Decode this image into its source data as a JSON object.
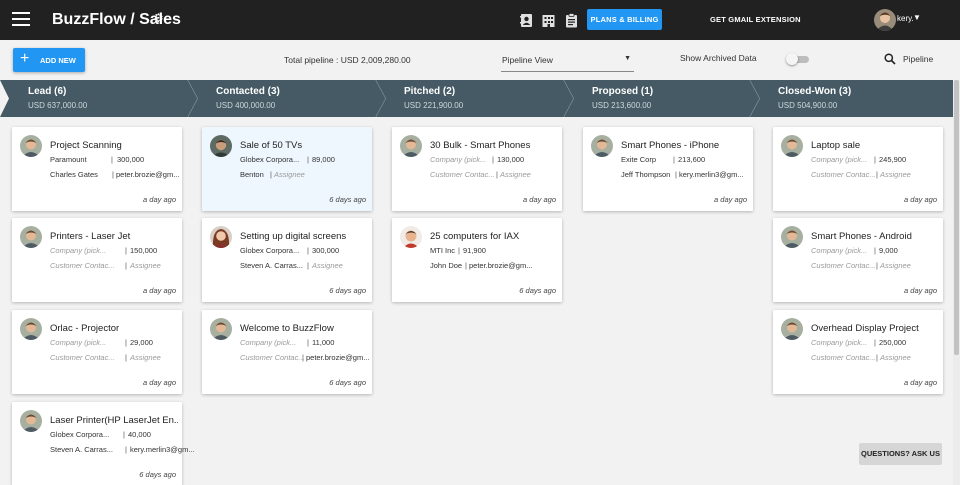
{
  "header": {
    "title": "BuzzFlow / Sales",
    "plans_button": "PLANS & BILLING",
    "gmail_extension": "GET GMAIL EXTENSION",
    "user_name": "kery.",
    "accent": "#2196f3",
    "bar_color": "#212121"
  },
  "toolbar": {
    "add_new": "ADD NEW",
    "total_pipeline": "Total pipeline : USD 2,009,280.00",
    "view_select": "Pipeline View",
    "archived_label": "Show Archived Data",
    "archived_on": false,
    "search_label": "Pipeline"
  },
  "stages": [
    {
      "name": "Lead (6)",
      "amount": "USD 637,000.00"
    },
    {
      "name": "Contacted (3)",
      "amount": "USD 400,000.00"
    },
    {
      "name": "Pitched (2)",
      "amount": "USD 221,900.00"
    },
    {
      "name": "Proposed (1)",
      "amount": "USD 213,600.00"
    },
    {
      "name": "Closed-Won (3)",
      "amount": "USD 504,900.00"
    }
  ],
  "cards": [
    {
      "title": "Project Scanning",
      "company": "Paramount",
      "value": "300,000",
      "contact": "Charles Gates",
      "assignee": "peter.brozie@gm...",
      "time": "a day ago"
    },
    {
      "title": "Printers - Laser Jet",
      "company": "Company (pick...",
      "value": "150,000",
      "contact": "Customer Contac...",
      "assignee": "Assignee",
      "time": "a day ago"
    },
    {
      "title": "Orlac - Projector",
      "company": "Company (pick...",
      "value": "29,000",
      "contact": "Customer Contac...",
      "assignee": "Assignee",
      "time": "a day ago"
    },
    {
      "title": "Laser Printer(HP LaserJet En...",
      "company": "Globex Corpora...",
      "value": "40,000",
      "contact": "Steven A. Carras...",
      "assignee": "kery.merlin3@gm...",
      "time": "6 days ago"
    },
    {
      "title": "Sale of 50 TVs",
      "company": "Globex Corpora...",
      "value": "89,000",
      "contact": "Benton",
      "assignee": "Assignee",
      "time": "6 days ago"
    },
    {
      "title": "Setting up digital screens",
      "company": "Globex Corpora...",
      "value": "300,000",
      "contact": "Steven A. Carras...",
      "assignee": "Assignee",
      "time": "6 days ago"
    },
    {
      "title": "Welcome to BuzzFlow",
      "company": "Company (pick...",
      "value": "11,000",
      "contact": "Customer Contac...",
      "assignee": "peter.brozie@gm...",
      "time": "6 days ago"
    },
    {
      "title": "30 Bulk - Smart Phones",
      "company": "Company (pick...",
      "value": "130,000",
      "contact": "Customer Contac...",
      "assignee": "Assignee",
      "time": "a day ago"
    },
    {
      "title": "25 computers for IAX",
      "company": "MTI Inc",
      "value": "91,900",
      "contact": "John Doe",
      "assignee": "peter.brozie@gm...",
      "time": "6 days ago"
    },
    {
      "title": "Smart Phones - iPhone",
      "company": "Exite Corp",
      "value": "213,600",
      "contact": "Jeff Thompson",
      "assignee": "kery.merlin3@gm...",
      "time": "a day ago"
    },
    {
      "title": "Laptop sale",
      "company": "Company (pick...",
      "value": "245,900",
      "contact": "Customer Contac...",
      "assignee": "Assignee",
      "time": "a day ago"
    },
    {
      "title": "Smart Phones - Android",
      "company": "Company (pick...",
      "value": "9,000",
      "contact": "Customer Contac...",
      "assignee": "Assignee",
      "time": "a day ago"
    },
    {
      "title": "Overhead Display Project",
      "company": "Company (pick...",
      "value": "250,000",
      "contact": "Customer Contac...",
      "assignee": "Assignee",
      "time": "a day ago"
    }
  ],
  "help_button": "QUESTIONS? ASK US"
}
